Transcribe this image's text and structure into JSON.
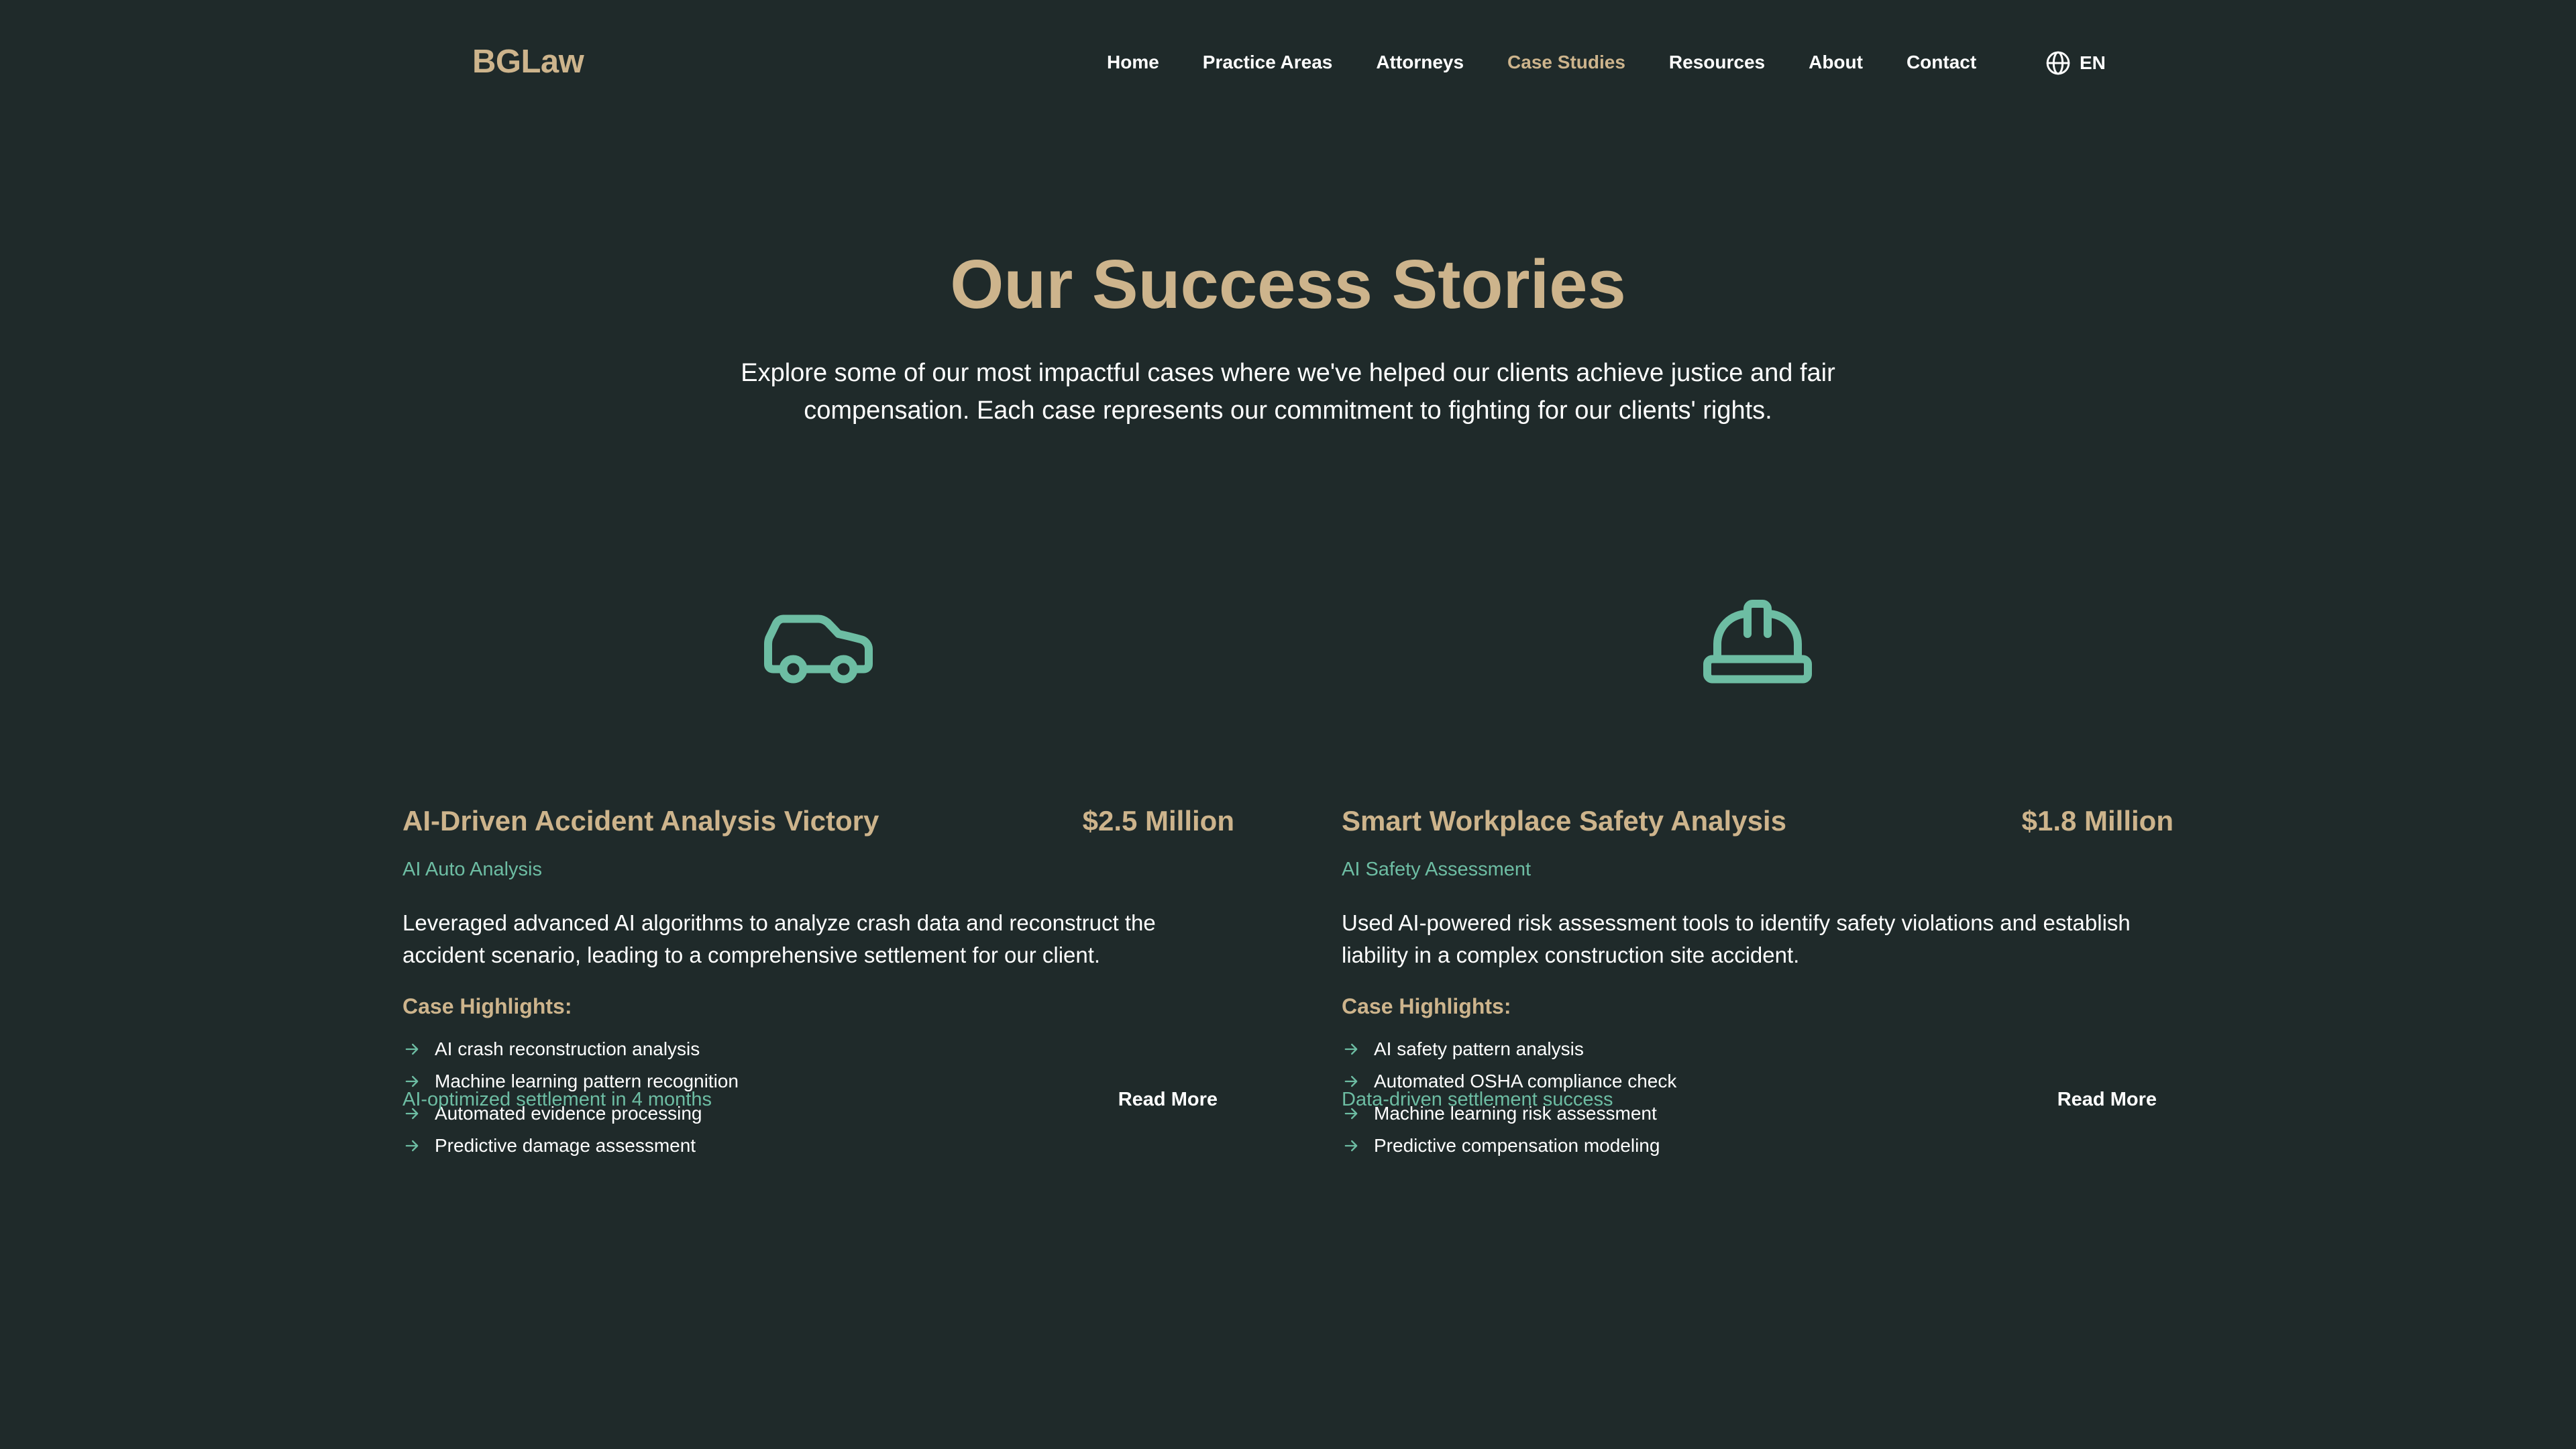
{
  "brand": {
    "logo": "BGLaw",
    "accent": "#cdb48c",
    "teal": "#6dbda3",
    "background": "#1f2a2a"
  },
  "nav": {
    "links": [
      "Home",
      "Practice Areas",
      "Attorneys",
      "Case Studies",
      "Resources",
      "About",
      "Contact"
    ],
    "active": "Case Studies",
    "language": "EN",
    "language_icon": "globe-icon"
  },
  "hero": {
    "title": "Our Success Stories",
    "subtitle": "Explore some of our most impactful cases where we've helped our clients achieve justice and fair compensation. Each case represents our commitment to fighting for our clients' rights."
  },
  "cases": [
    {
      "icon": "car-icon",
      "title": "AI-Driven Accident Analysis Victory",
      "amount": "$2.5 Million",
      "category": "AI Auto Analysis",
      "description": "Leveraged advanced AI algorithms to analyze crash data and reconstruct the accident scenario, leading to a comprehensive settlement for our client.",
      "highlights_title": "Case Highlights:",
      "highlights": [
        "AI crash reconstruction analysis",
        "Machine learning pattern recognition",
        "Automated evidence processing",
        "Predictive damage assessment"
      ],
      "result": "AI-optimized settlement in 4 months",
      "cta": "Read More"
    },
    {
      "icon": "hard-hat-icon",
      "title": "Smart Workplace Safety Analysis",
      "amount": "$1.8 Million",
      "category": "AI Safety Assessment",
      "description": "Used AI-powered risk assessment tools to identify safety violations and establish liability in a complex construction site accident.",
      "highlights_title": "Case Highlights:",
      "highlights": [
        "AI safety pattern analysis",
        "Automated OSHA compliance check",
        "Machine learning risk assessment",
        "Predictive compensation modeling"
      ],
      "result": "Data-driven settlement success",
      "cta": "Read More"
    }
  ]
}
